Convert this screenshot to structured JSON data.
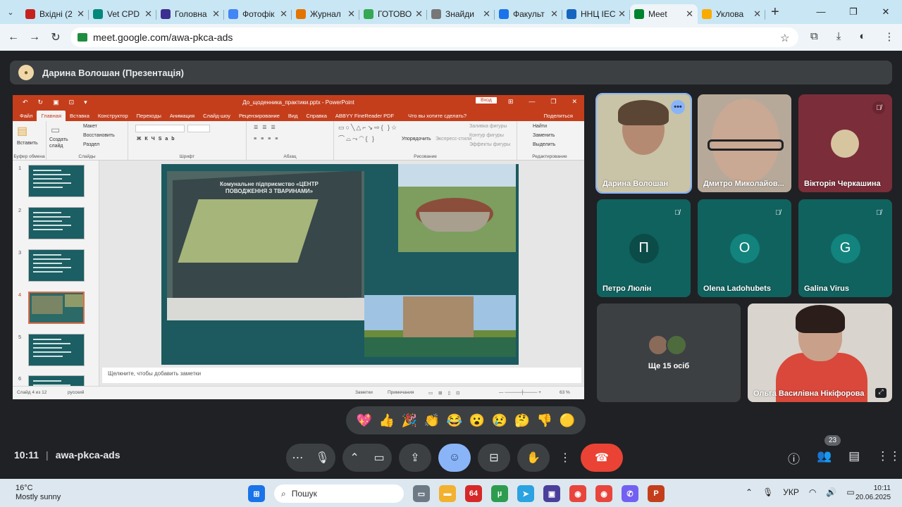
{
  "browser": {
    "tabs": [
      {
        "title": "Вхідні (2",
        "color": "#c5221f"
      },
      {
        "title": "Vet CPD",
        "color": "#00897b"
      },
      {
        "title": "Головна",
        "color": "#3b2f8f"
      },
      {
        "title": "Фотофік",
        "color": "#4285f4"
      },
      {
        "title": "Журнал",
        "color": "#e37400"
      },
      {
        "title": "ГОТОВО",
        "color": "#34a853"
      },
      {
        "title": "Знайди",
        "color": "#777777"
      },
      {
        "title": "Факульт",
        "color": "#1a73e8"
      },
      {
        "title": "ННЦ ІЕС",
        "color": "#1565c0"
      },
      {
        "title": "Meet",
        "color": "#00832d"
      },
      {
        "title": "Уклова",
        "color": "#f9ab00"
      }
    ],
    "url": "meet.google.com/awa-pkca-ads"
  },
  "presentation_bar": {
    "title": "Дарина Волошан (Презентація)"
  },
  "ppt": {
    "file_title": "До_щоденника_практики.pptx - PowerPoint",
    "login": "Вход",
    "menu": [
      "Файл",
      "Главная",
      "Вставка",
      "Конструктор",
      "Переходы",
      "Анимация",
      "Слайд-шоу",
      "Рецензирование",
      "Вид",
      "Справка",
      "ABBYY FineReader PDF"
    ],
    "help": "Что вы хотите сделать?",
    "share": "Поделиться",
    "groups": {
      "clipboard": "Буфер обмена",
      "paste": "Вставить",
      "slides": "Слайды",
      "new_slide": "Создать слайд",
      "layout": "Макет",
      "reset": "Восстановить",
      "section": "Раздел",
      "font": "Шрифт",
      "paragraph": "Абзац",
      "drawing": "Рисование",
      "arrange": "Упорядочить",
      "quick_styles": "Экспресс-стили",
      "fill": "Заливка фигуры",
      "outline": "Контур фигуры",
      "effects": "Эффекты фигуры",
      "editing": "Редактирование",
      "find": "Найти",
      "replace": "Заменить",
      "select": "Выделить"
    },
    "slide_numbers": [
      "1",
      "2",
      "3",
      "4",
      "5",
      "6"
    ],
    "selected_slide": 4,
    "slide_banner_title": "Комунальне підприємство «ЦЕНТР ПОВОДЖЕННЯ З ТВАРИНАМИ»",
    "notes_placeholder": "Щелкните, чтобы добавить заметки",
    "status_slide": "Слайд 4 из 12",
    "status_lang": "русский",
    "status_notes": "Заметки",
    "status_comments": "Примечания",
    "zoom": "63 %"
  },
  "participants": [
    {
      "name": "Дарина Волошан",
      "bg": "#c9c3a8"
    },
    {
      "name": "Дмитро Миколайов...",
      "bg": "#b7a99a"
    },
    {
      "name": "Вікторія Черкашина",
      "bg": "#7b2d3a"
    },
    {
      "name": "Петро Люлін",
      "letter": "П",
      "bg": "#10625f",
      "avatar": "#0b4b48"
    },
    {
      "name": "Olena Ladohubets",
      "letter": "O",
      "bg": "#10625f",
      "avatar": "#12837d"
    },
    {
      "name": "Galina Virus",
      "letter": "G",
      "bg": "#10625f",
      "avatar": "#12837d"
    }
  ],
  "others": {
    "label": "Ще 15 осіб"
  },
  "spotlight": {
    "name": "Ольга Василівна Нікіфорова"
  },
  "reactions": [
    "💖",
    "👍",
    "🎉",
    "👏",
    "😂",
    "😮",
    "😢",
    "🤔",
    "👎",
    "🟡"
  ],
  "meeting": {
    "time": "10:11",
    "code": "awa-pkca-ads",
    "participant_count": "23"
  },
  "taskbar": {
    "temp": "16°C",
    "weather": "Mostly sunny",
    "search": "Пошук",
    "lang": "УКР",
    "time": "10:11",
    "date": "20.06.2025"
  }
}
